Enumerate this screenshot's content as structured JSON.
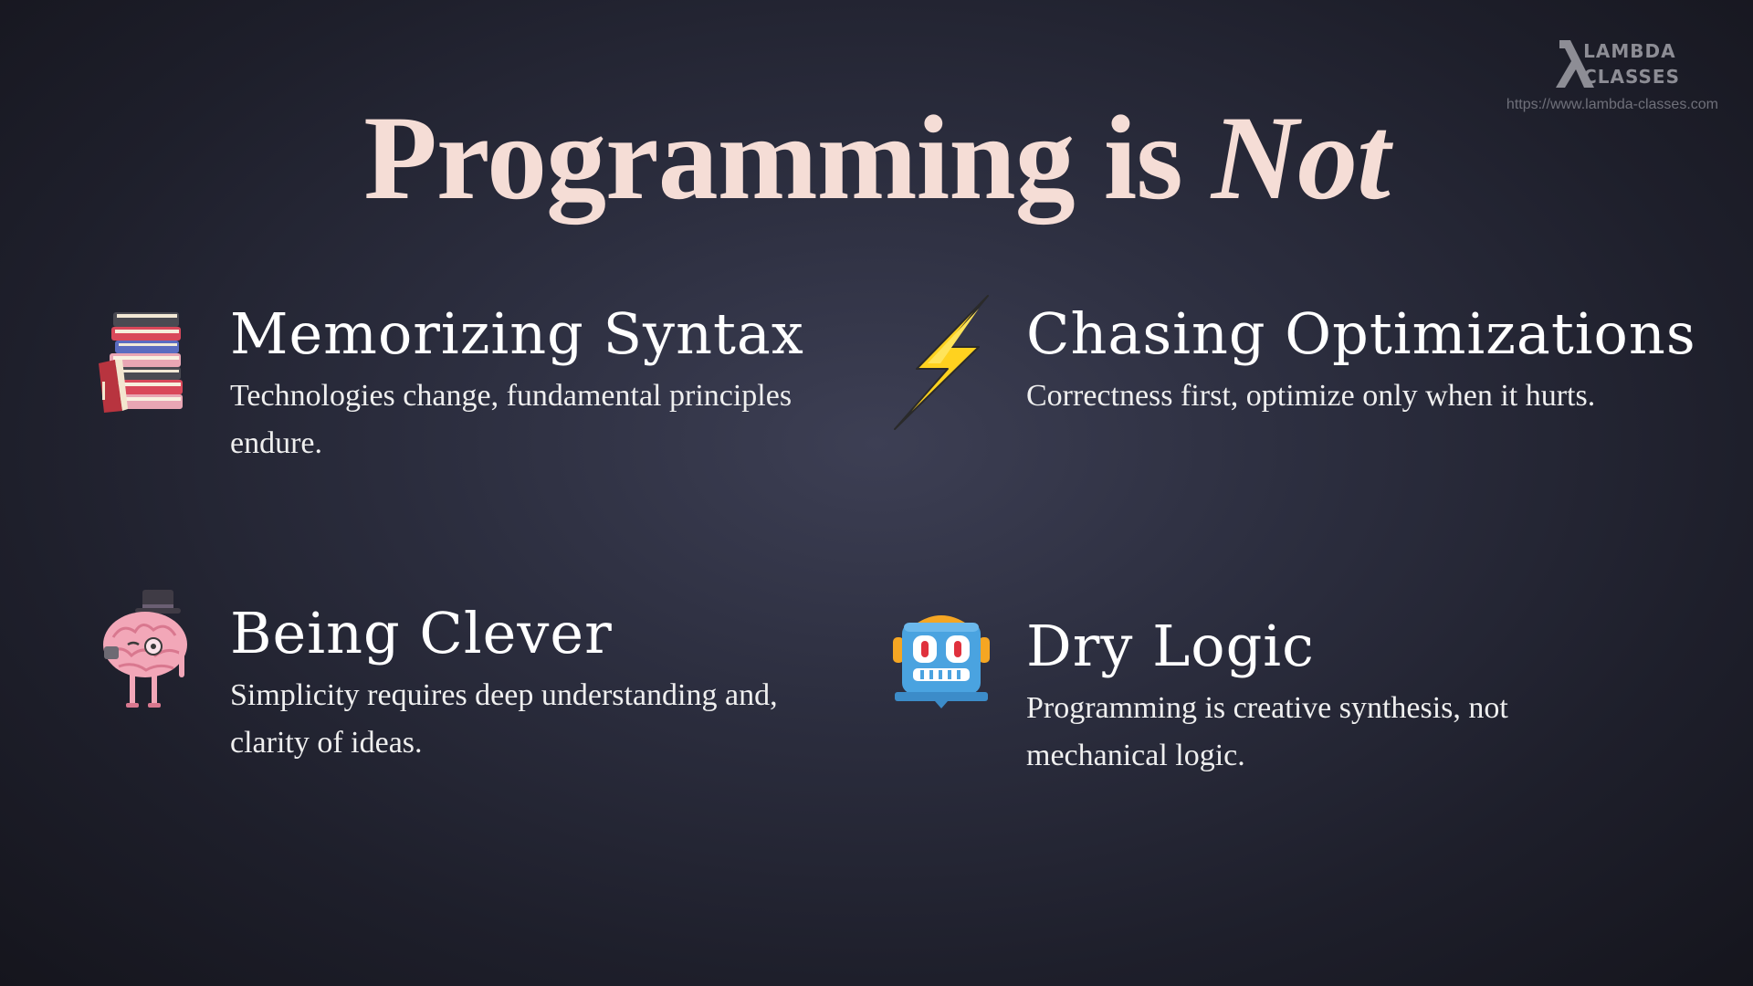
{
  "logo": {
    "line1": "LAMBDA",
    "line2": "CLASSES",
    "url": "https://www.lambda-classes.com"
  },
  "title": {
    "main": "Programming is ",
    "emphasis": "Not"
  },
  "cards": [
    {
      "icon": "books-icon",
      "heading": "Memorizing Syntax",
      "body": "Technologies change, fundamental principles endure."
    },
    {
      "icon": "lightning-icon",
      "heading": "Chasing Optimizations",
      "body": "Correctness first, optimize only when it hurts."
    },
    {
      "icon": "brain-icon",
      "heading": "Being Clever",
      "body": "Simplicity requires deep understanding and, clarity of ideas."
    },
    {
      "icon": "robot-icon",
      "heading": "Dry Logic",
      "body": "Programming is creative synthesis, not mechanical logic."
    }
  ],
  "colors": {
    "title": "#f5ddd6",
    "heading": "#ffffff",
    "body": "#efefef",
    "logo": "#8d8d95"
  }
}
